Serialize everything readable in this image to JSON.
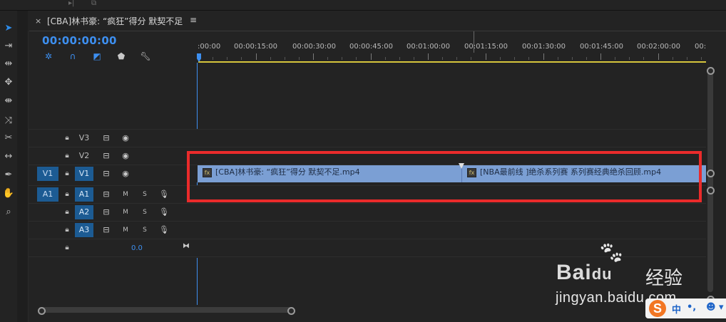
{
  "window": {
    "tab_title": "[CBA]林书豪: “疯狂”得分 默契不足",
    "tab_close": "×",
    "tab_menu": "≡"
  },
  "timecode": "00:00:00:00",
  "ruler": {
    "labels": [
      ":00:00",
      "00:00:15:00",
      "00:00:30:00",
      "00:00:45:00",
      "00:01:00:00",
      "00:01:15:00",
      "00:01:30:00",
      "00:01:45:00",
      "00:02:00:00",
      "00:"
    ]
  },
  "tracks": {
    "video": [
      {
        "name": "V3",
        "target": ""
      },
      {
        "name": "V2",
        "target": ""
      },
      {
        "name": "V1",
        "target": "V1"
      }
    ],
    "audio": [
      {
        "name": "A1",
        "target": "A1",
        "m": "M",
        "s": "S"
      },
      {
        "name": "A2",
        "target": "",
        "m": "M",
        "s": "S"
      },
      {
        "name": "A3",
        "target": "",
        "m": "M",
        "s": "S"
      }
    ],
    "master_volume": "0.0"
  },
  "clips": [
    {
      "name": "[CBA]林书豪: “疯狂”得分 默契不足.mp4",
      "fx": "fx"
    },
    {
      "name": "[NBA最前线 ]绝杀系列赛 系列赛经典绝杀回顾.mp4",
      "fx": "fx"
    }
  ],
  "watermark": {
    "logo": "Bai",
    "logo_paw": "du",
    "sub": "经验",
    "url": "jingyan.baidu.com"
  },
  "ime": {
    "logo": "S",
    "lang": "中",
    "punct": "•,",
    "emoji": "☻",
    "more": "▾"
  },
  "colors": {
    "accent": "#3d8ff0",
    "clip": "#7b9fd4",
    "highlight": "#ea2b2b",
    "track_target": "#1c5b93",
    "work_area": "#d6c63c"
  }
}
